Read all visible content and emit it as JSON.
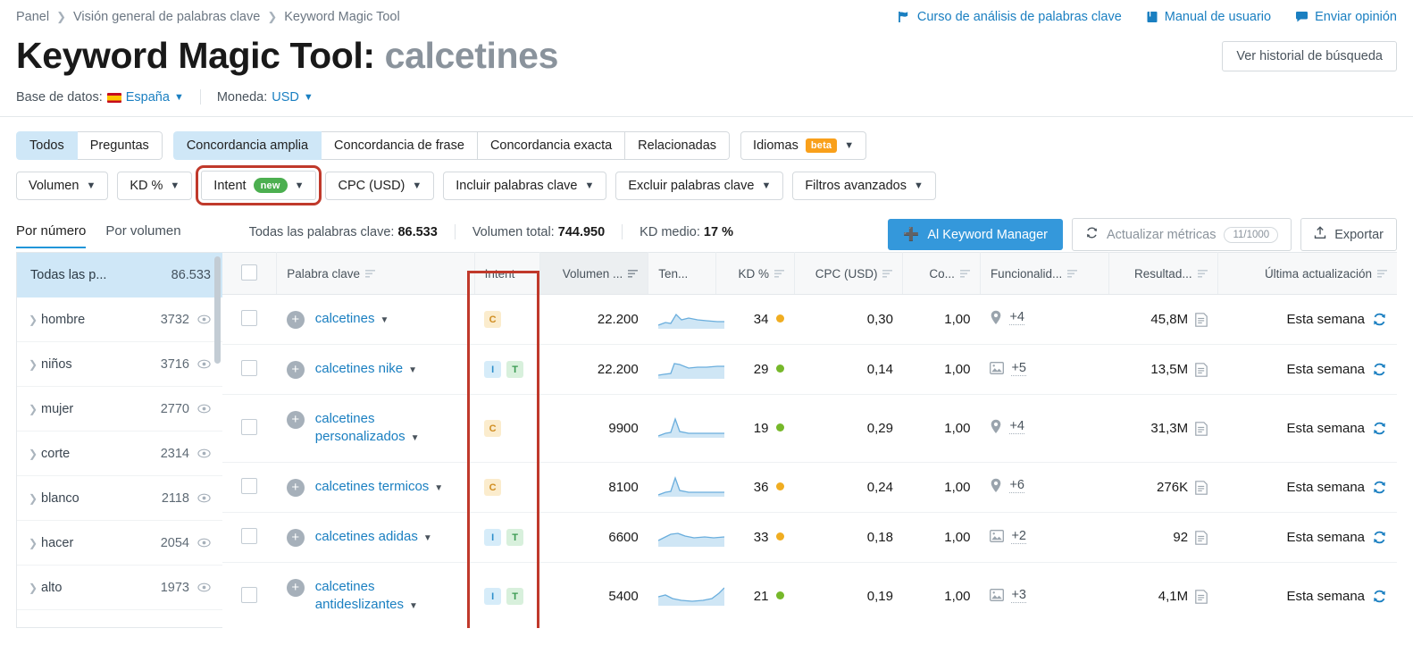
{
  "breadcrumb": [
    "Panel",
    "Visión general de palabras clave",
    "Keyword Magic Tool"
  ],
  "top_links": [
    {
      "label": "Curso de análisis de palabras clave",
      "icon": "flag-icon"
    },
    {
      "label": "Manual de usuario",
      "icon": "book-icon"
    },
    {
      "label": "Enviar opinión",
      "icon": "speech-bubble-icon"
    }
  ],
  "title": {
    "main": "Keyword Magic Tool:",
    "term": "calcetines"
  },
  "history_button": "Ver historial de búsqueda",
  "database": {
    "label": "Base de datos:",
    "value": "España"
  },
  "currency": {
    "label": "Moneda:",
    "value": "USD"
  },
  "match_tabs": [
    {
      "label": "Todos",
      "active": true
    },
    {
      "label": "Preguntas",
      "active": false
    },
    {
      "label": "Concordancia amplia",
      "active": true
    },
    {
      "label": "Concordancia de frase",
      "active": false
    },
    {
      "label": "Concordancia exacta",
      "active": false
    },
    {
      "label": "Relacionadas",
      "active": false
    }
  ],
  "languages_filter": {
    "label": "Idiomas",
    "badge": "beta"
  },
  "filters": [
    {
      "label": "Volumen",
      "badge": null,
      "highlighted": false
    },
    {
      "label": "KD %",
      "badge": null,
      "highlighted": false
    },
    {
      "label": "Intent",
      "badge": "new",
      "highlighted": true
    },
    {
      "label": "CPC (USD)",
      "badge": null,
      "highlighted": false
    },
    {
      "label": "Incluir palabras clave",
      "badge": null,
      "highlighted": false
    },
    {
      "label": "Excluir palabras clave",
      "badge": null,
      "highlighted": false
    },
    {
      "label": "Filtros avanzados",
      "badge": null,
      "highlighted": false
    }
  ],
  "subtabs": [
    {
      "label": "Por número",
      "active": true
    },
    {
      "label": "Por volumen",
      "active": false
    }
  ],
  "stats": [
    {
      "label": "Todas las palabras clave:",
      "value": "86.533"
    },
    {
      "label": "Volumen total:",
      "value": "744.950"
    },
    {
      "label": "KD medio:",
      "value": "17 %"
    }
  ],
  "actions": {
    "keyword_manager": "Al Keyword Manager",
    "refresh_metrics": "Actualizar métricas",
    "refresh_counter": "11/1000",
    "export": "Exportar"
  },
  "sidebar": {
    "header": {
      "label": "Todas las p...",
      "count": "86.533"
    },
    "items": [
      {
        "label": "hombre",
        "count": "3732"
      },
      {
        "label": "niños",
        "count": "3716"
      },
      {
        "label": "mujer",
        "count": "2770"
      },
      {
        "label": "corte",
        "count": "2314"
      },
      {
        "label": "blanco",
        "count": "2118"
      },
      {
        "label": "hacer",
        "count": "2054"
      },
      {
        "label": "alto",
        "count": "1973"
      }
    ]
  },
  "table": {
    "columns": [
      {
        "key": "checkbox",
        "label": "",
        "sortable": false
      },
      {
        "key": "keyword",
        "label": "Palabra clave",
        "sortable": true
      },
      {
        "key": "intent",
        "label": "Intent",
        "sortable": false
      },
      {
        "key": "volume",
        "label": "Volumen ...",
        "sortable": true,
        "sorted": true
      },
      {
        "key": "trend",
        "label": "Ten...",
        "sortable": false
      },
      {
        "key": "kd",
        "label": "KD %",
        "sortable": true
      },
      {
        "key": "cpc",
        "label": "CPC (USD)",
        "sortable": true
      },
      {
        "key": "com",
        "label": "Co...",
        "sortable": true
      },
      {
        "key": "features",
        "label": "Funcionalid...",
        "sortable": true
      },
      {
        "key": "results",
        "label": "Resultad...",
        "sortable": true
      },
      {
        "key": "updated",
        "label": "Última actualización",
        "sortable": true
      }
    ],
    "rows": [
      {
        "keyword": "calcetines",
        "intents": [
          "C"
        ],
        "volume": "22.200",
        "trend": "rise-fall",
        "kd": "34",
        "kd_color": "yellow",
        "cpc": "0,30",
        "com": "1,00",
        "feature_icon": "map-pin-icon",
        "features": "+4",
        "results": "45,8M",
        "updated": "Esta semana"
      },
      {
        "keyword": "calcetines nike",
        "intents": [
          "I",
          "T"
        ],
        "volume": "22.200",
        "trend": "plateau",
        "kd": "29",
        "kd_color": "green",
        "cpc": "0,14",
        "com": "1,00",
        "feature_icon": "image-icon",
        "features": "+5",
        "results": "13,5M",
        "updated": "Esta semana"
      },
      {
        "keyword": "calcetines personalizados",
        "intents": [
          "C"
        ],
        "volume": "9900",
        "trend": "spike",
        "kd": "19",
        "kd_color": "green",
        "cpc": "0,29",
        "com": "1,00",
        "feature_icon": "map-pin-icon",
        "features": "+4",
        "results": "31,3M",
        "updated": "Esta semana"
      },
      {
        "keyword": "calcetines termicos",
        "intents": [
          "C"
        ],
        "volume": "8100",
        "trend": "spike",
        "kd": "36",
        "kd_color": "yellow",
        "cpc": "0,24",
        "com": "1,00",
        "feature_icon": "map-pin-icon",
        "features": "+6",
        "results": "276K",
        "updated": "Esta semana"
      },
      {
        "keyword": "calcetines adidas",
        "intents": [
          "I",
          "T"
        ],
        "volume": "6600",
        "trend": "wave",
        "kd": "33",
        "kd_color": "yellow",
        "cpc": "0,18",
        "com": "1,00",
        "feature_icon": "image-icon",
        "features": "+2",
        "results": "92",
        "updated": "Esta semana"
      },
      {
        "keyword": "calcetines antideslizantes",
        "intents": [
          "I",
          "T"
        ],
        "volume": "5400",
        "trend": "dip-rise",
        "kd": "21",
        "kd_color": "green",
        "cpc": "0,19",
        "com": "1,00",
        "feature_icon": "image-icon",
        "features": "+3",
        "results": "4,1M",
        "updated": "Esta semana"
      }
    ]
  },
  "colors": {
    "accent_blue": "#1a7fc1",
    "primary_button": "#3498db",
    "highlight_red": "#c0392b",
    "active_tab_bg": "#cfe7f7",
    "badge_beta": "#f9a01b",
    "badge_new": "#4caf50",
    "kd_green": "#76b82a",
    "kd_yellow": "#f0ad21"
  }
}
